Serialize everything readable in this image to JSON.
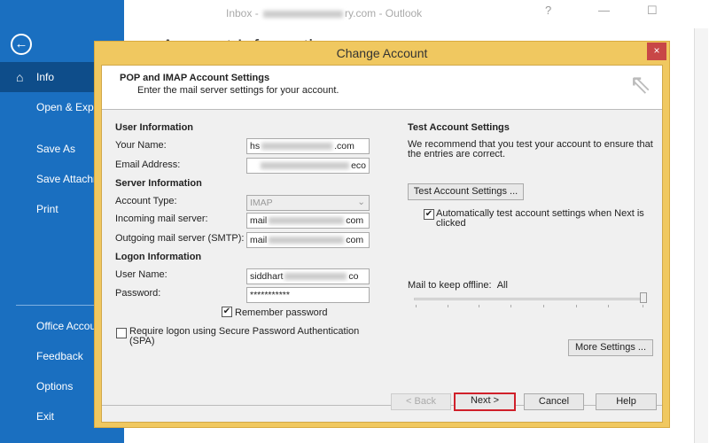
{
  "window": {
    "title_prefix": "Inbox - ",
    "title_suffix": "ry.com - Outlook",
    "heading": "Account Information"
  },
  "sidebar": {
    "items": [
      {
        "label": "Info"
      },
      {
        "label": "Open & Export"
      },
      {
        "label": "Save As"
      },
      {
        "label": "Save Attachments"
      },
      {
        "label": "Print"
      },
      {
        "label": "Office Account"
      },
      {
        "label": "Feedback"
      },
      {
        "label": "Options"
      },
      {
        "label": "Exit"
      }
    ]
  },
  "dialog": {
    "title": "Change Account",
    "close": "×",
    "header": {
      "title": "POP and IMAP Account Settings",
      "subtitle": "Enter the mail server settings for your account."
    },
    "user_info": {
      "heading": "User Information",
      "name_label": "Your Name:",
      "name_value_start": "hs",
      "name_value_end": ".com",
      "email_label": "Email Address:",
      "email_value_end": "eco"
    },
    "server_info": {
      "heading": "Server Information",
      "account_type_label": "Account Type:",
      "account_type_value": "IMAP",
      "incoming_label": "Incoming mail server:",
      "incoming_start": "mail",
      "incoming_end": "com",
      "outgoing_label": "Outgoing mail server (SMTP):",
      "outgoing_start": "mail",
      "outgoing_end": "com"
    },
    "logon_info": {
      "heading": "Logon Information",
      "user_label": "User Name:",
      "user_start": "siddhart",
      "user_end": "co",
      "password_label": "Password:",
      "password_value": "***********",
      "remember_label": "Remember password",
      "spa_label": "Require logon using Secure Password Authentication (SPA)"
    },
    "test": {
      "heading": "Test Account Settings",
      "description": "We recommend that you test your account to ensure that the entries are correct.",
      "button": "Test Account Settings ...",
      "auto_label": "Automatically test account settings when Next is clicked"
    },
    "offline": {
      "label": "Mail to keep offline:",
      "value": "All",
      "slider_fraction": 1.0
    },
    "more_settings": "More Settings ...",
    "buttons": {
      "back": "< Back",
      "next": "Next >",
      "cancel": "Cancel",
      "help": "Help"
    }
  }
}
